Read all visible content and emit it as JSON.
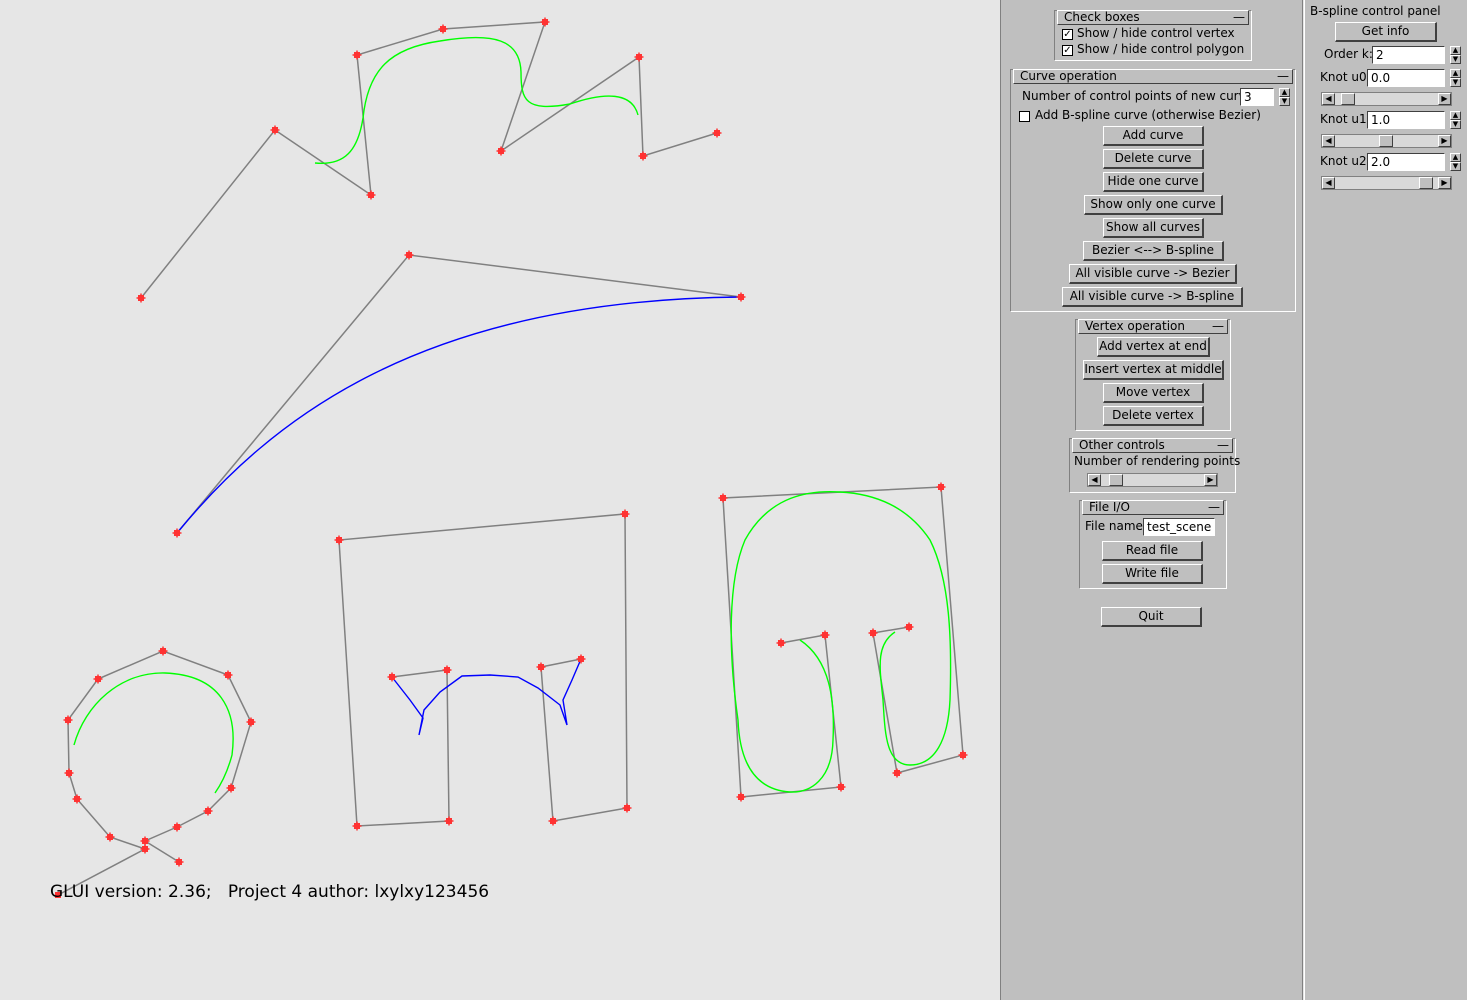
{
  "footer": {
    "text": "GLUI version: 2.36;   Project 4 author: lxylxy123456"
  },
  "colors": {
    "polygon": "#808080",
    "vertex": "#ff3333",
    "bspline_curve": "#00ff00",
    "bezier_curve": "#0000ff"
  },
  "check_boxes": {
    "title": "Check boxes",
    "items": [
      {
        "label": "Show / hide control vertex",
        "checked": true,
        "mark": "✓"
      },
      {
        "label": "Show / hide control polygon",
        "checked": true,
        "mark": "✓"
      }
    ]
  },
  "curve_operation": {
    "title": "Curve operation",
    "num_points_label": "Number of control points of new curve:",
    "num_points_value": "3",
    "add_bspline_label": "Add B-spline curve (otherwise Bezier)",
    "add_bspline_checked": false,
    "buttons": [
      "Add curve",
      "Delete curve",
      "Hide one curve",
      "Show only one curve",
      "Show all curves",
      "Bezier <--> B-spline",
      "All visible curve -> Bezier",
      "All visible curve -> B-spline"
    ]
  },
  "vertex_operation": {
    "title": "Vertex operation",
    "buttons": [
      "Add vertex at end",
      "Insert vertex at middle",
      "Move vertex",
      "Delete vertex"
    ]
  },
  "other_controls": {
    "title": "Other controls",
    "rendering_label": "Number of rendering points"
  },
  "file_io": {
    "title": "File I/O",
    "file_name_label": "File name",
    "file_name_value": "test_scene",
    "buttons": [
      "Read file",
      "Write file"
    ]
  },
  "quit_label": "Quit",
  "bspline_panel": {
    "title": "B-spline control panel",
    "get_info_label": "Get info",
    "order_label": "Order k:",
    "order_value": "2",
    "knots": [
      {
        "label": "Knot u0",
        "value": "0.0"
      },
      {
        "label": "Knot u1",
        "value": "1.0"
      },
      {
        "label": "Knot u2",
        "value": "2.0"
      }
    ]
  },
  "icons": {
    "rollout_toggle": "minus-icon",
    "spinner": "spinner-arrows-icon",
    "scroll_left": "arrow-left-icon",
    "scroll_right": "arrow-right-icon"
  }
}
